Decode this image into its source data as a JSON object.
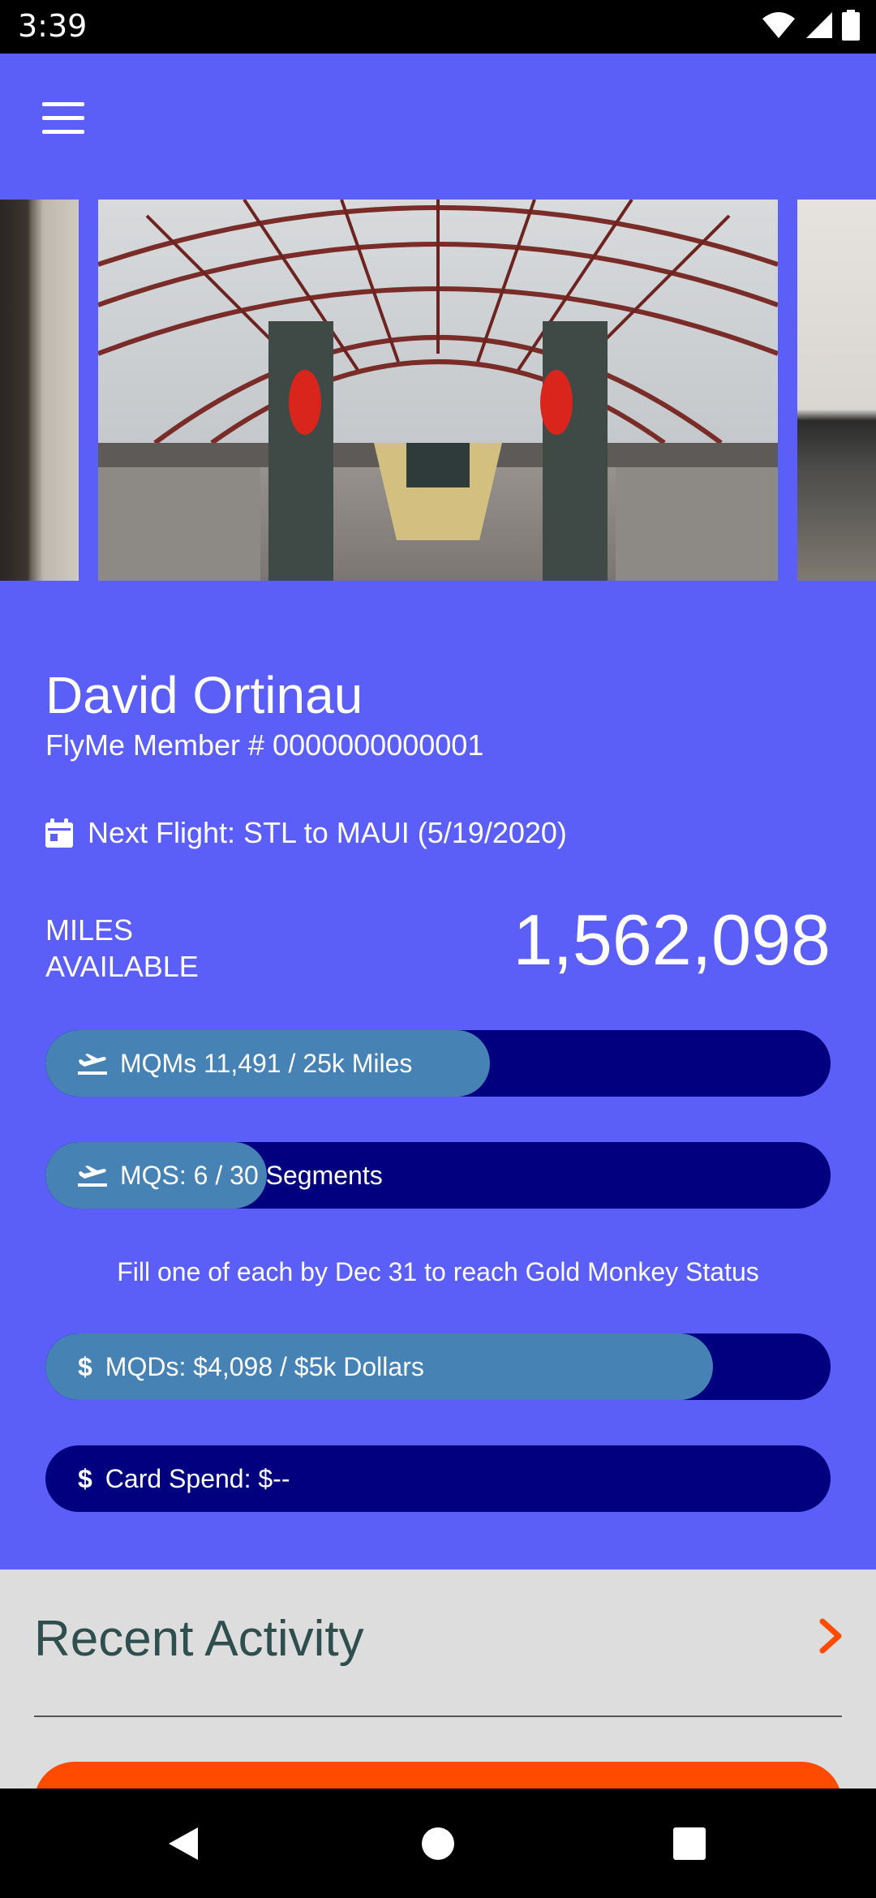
{
  "status_bar": {
    "time": "3:39"
  },
  "profile": {
    "name": "David Ortinau",
    "member_line": "FlyMe Member # 0000000000001"
  },
  "next_flight": {
    "label": "Next Flight: STL to MAUI (5/19/2020)"
  },
  "miles": {
    "label_line1": "MILES",
    "label_line2": "AVAILABLE",
    "value": "1,562,098"
  },
  "progress": {
    "mqm": {
      "label": "MQMs 11,491 / 25k Miles",
      "percent": 56.6
    },
    "mqs": {
      "label": "MQS: 6 / 30 Segments",
      "percent": 28.2
    },
    "note": "Fill one of each by Dec 31 to reach Gold Monkey Status",
    "mqd": {
      "label": "MQDs: $4,098 / $5k Dollars",
      "percent": 85.0
    },
    "card": {
      "label": "Card Spend: $--",
      "percent": 0
    }
  },
  "recent_activity": {
    "title": "Recent Activity"
  },
  "colors": {
    "background": "#5B5FF7",
    "bar_track": "#02007F",
    "bar_fill": "#4682B4",
    "recent_bg": "#DDDDDD",
    "accent": "#FF4B00"
  },
  "icons": {
    "menu": "hamburger-menu-icon",
    "calendar": "calendar-icon",
    "flight": "airplane-takeoff-icon",
    "dollar": "dollar-icon",
    "chevron": "chevron-right-icon"
  }
}
